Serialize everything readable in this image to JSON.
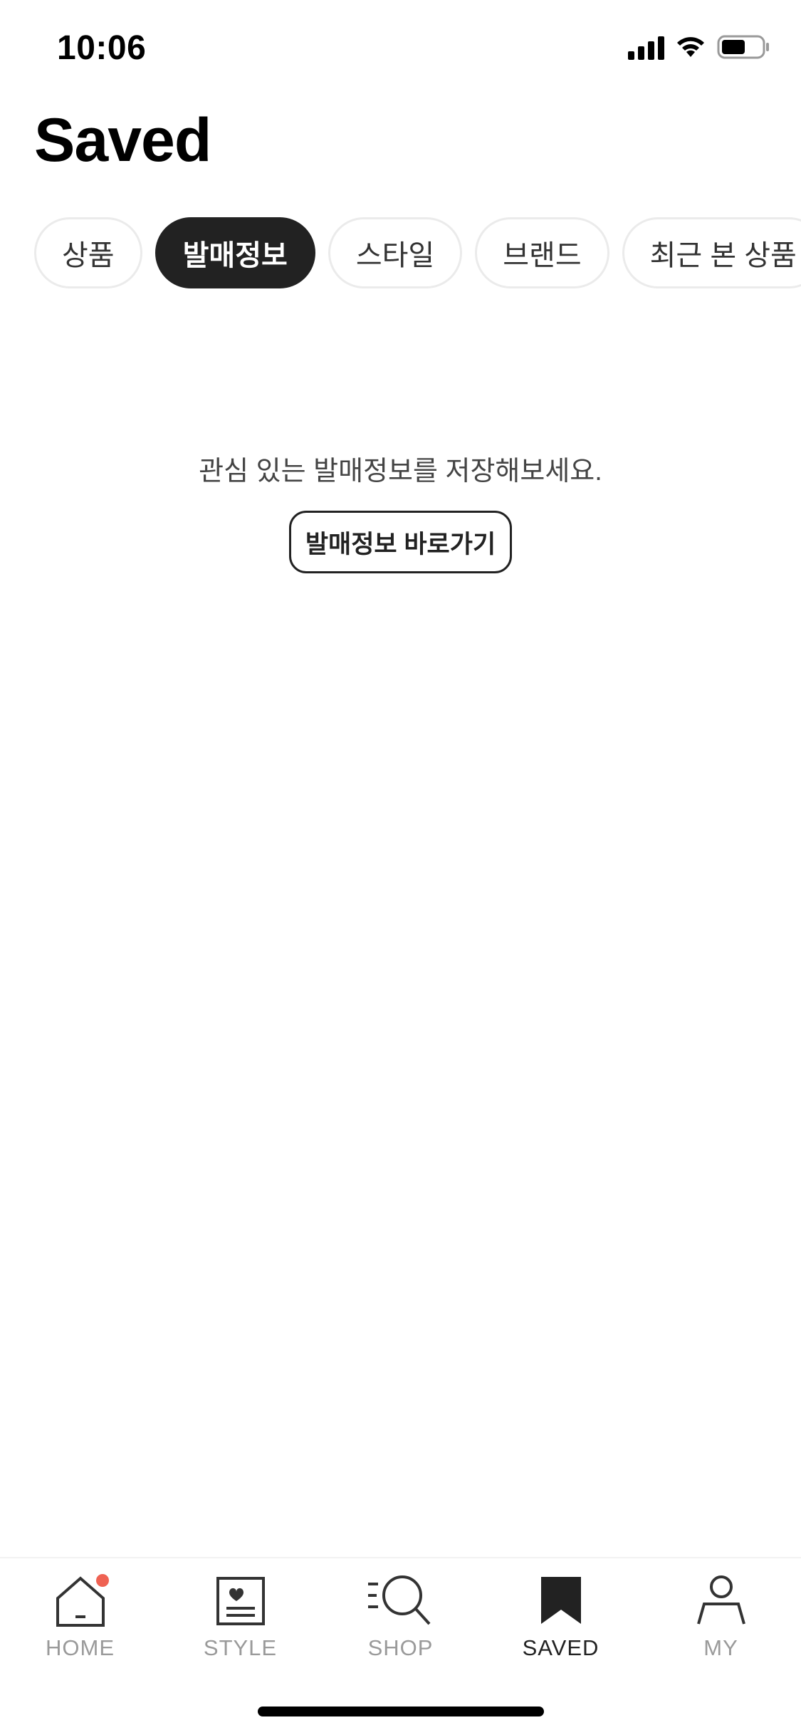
{
  "status_bar": {
    "time": "10:06",
    "icons": [
      "cellular-signal-icon",
      "wifi-icon",
      "battery-icon"
    ]
  },
  "page_title": "Saved",
  "tabs": [
    {
      "label": "상품",
      "active": false
    },
    {
      "label": "발매정보",
      "active": true
    },
    {
      "label": "스타일",
      "active": false
    },
    {
      "label": "브랜드",
      "active": false
    },
    {
      "label": "최근 본 상품",
      "active": false
    }
  ],
  "empty_state": {
    "message": "관심 있는 발매정보를 저장해보세요.",
    "button_label": "발매정보 바로가기"
  },
  "bottom_nav": {
    "items": [
      {
        "label": "HOME",
        "icon": "home-icon",
        "active": false,
        "has_badge": true
      },
      {
        "label": "STYLE",
        "icon": "style-icon",
        "active": false
      },
      {
        "label": "SHOP",
        "icon": "search-icon",
        "active": false
      },
      {
        "label": "SAVED",
        "icon": "bookmark-icon",
        "active": true
      },
      {
        "label": "MY",
        "icon": "person-icon",
        "active": false
      }
    ]
  },
  "colors": {
    "active_tab_bg": "#222222",
    "badge": "#ef6253",
    "inactive_nav": "#9a9a9a"
  }
}
